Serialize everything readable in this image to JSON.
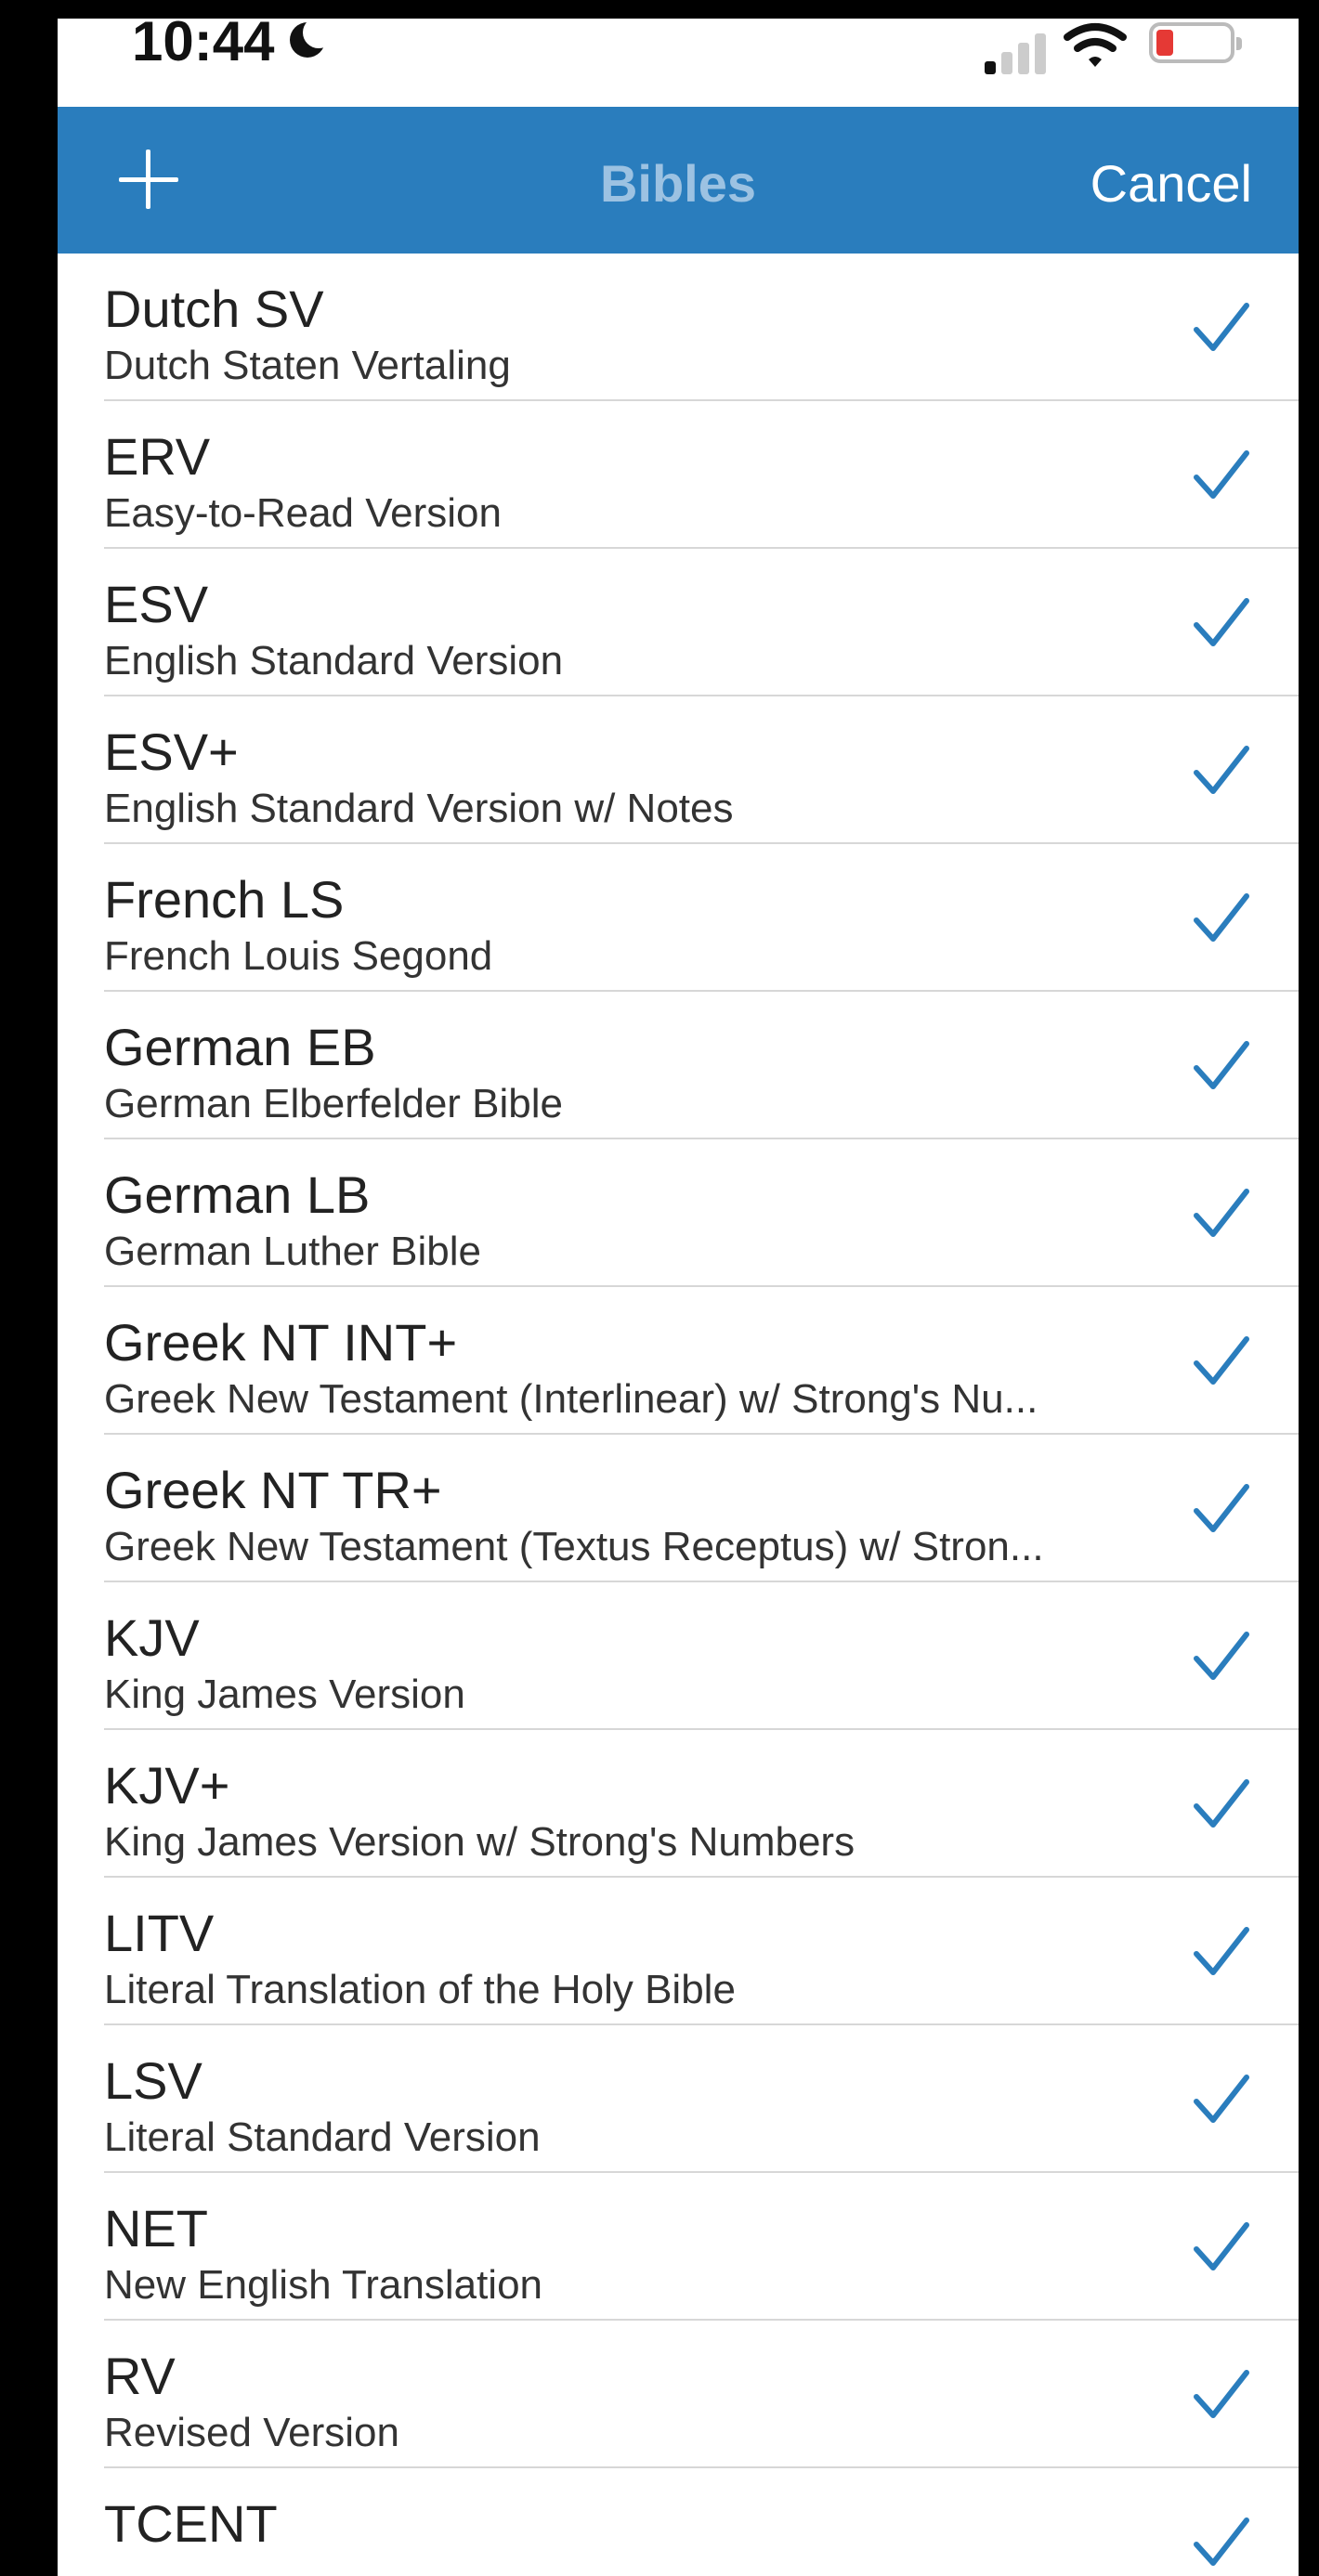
{
  "status_bar": {
    "time": "10:44"
  },
  "nav_bar": {
    "title": "Bibles",
    "cancel_label": "Cancel"
  },
  "colors": {
    "nav_background": "#2a7dbd",
    "check_color": "#2a7dbd",
    "battery_low": "#e53935"
  },
  "bibles": [
    {
      "abbr": "Dutch SV",
      "name": "Dutch Staten Vertaling",
      "checked": true
    },
    {
      "abbr": "ERV",
      "name": "Easy-to-Read Version",
      "checked": true
    },
    {
      "abbr": "ESV",
      "name": "English Standard Version",
      "checked": true
    },
    {
      "abbr": "ESV+",
      "name": "English Standard Version w/ Notes",
      "checked": true
    },
    {
      "abbr": "French LS",
      "name": "French Louis Segond",
      "checked": true
    },
    {
      "abbr": "German EB",
      "name": "German Elberfelder Bible",
      "checked": true
    },
    {
      "abbr": "German LB",
      "name": "German Luther Bible",
      "checked": true
    },
    {
      "abbr": "Greek NT INT+",
      "name": "Greek New Testament (Interlinear) w/ Strong's Nu...",
      "checked": true
    },
    {
      "abbr": "Greek NT TR+",
      "name": "Greek New Testament (Textus Receptus) w/ Stron...",
      "checked": true
    },
    {
      "abbr": "KJV",
      "name": "King James Version",
      "checked": true
    },
    {
      "abbr": "KJV+",
      "name": "King James Version w/ Strong's Numbers",
      "checked": true
    },
    {
      "abbr": "LITV",
      "name": "Literal Translation of the Holy Bible",
      "checked": true
    },
    {
      "abbr": "LSV",
      "name": "Literal Standard Version",
      "checked": true
    },
    {
      "abbr": "NET",
      "name": "New English Translation",
      "checked": true
    },
    {
      "abbr": "RV",
      "name": "Revised Version",
      "checked": true
    },
    {
      "abbr": "TCENT",
      "name": "",
      "checked": true
    }
  ]
}
